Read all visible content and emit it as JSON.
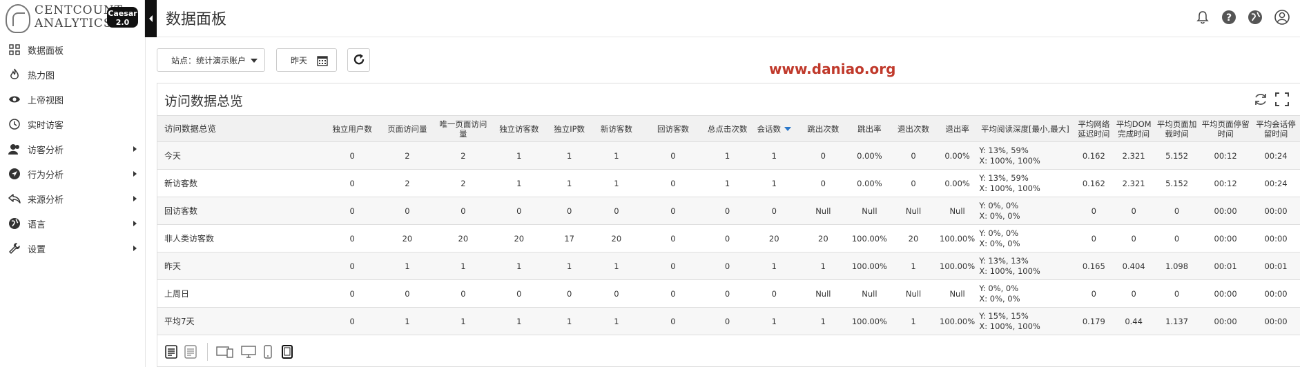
{
  "brand": {
    "line1": "CENTCOUNT",
    "line2": "ANALYTICS",
    "badge_name": "Caesar",
    "badge_version": "2.0"
  },
  "sidebar": {
    "items": [
      {
        "label": "数据面板",
        "icon": "dashboard-icon",
        "has_submenu": false
      },
      {
        "label": "热力图",
        "icon": "flame-icon",
        "has_submenu": false
      },
      {
        "label": "上帝视图",
        "icon": "eye-icon",
        "has_submenu": false
      },
      {
        "label": "实时访客",
        "icon": "clock-icon",
        "has_submenu": false
      },
      {
        "label": "访客分析",
        "icon": "users-icon",
        "has_submenu": true
      },
      {
        "label": "行为分析",
        "icon": "navigation-icon",
        "has_submenu": true
      },
      {
        "label": "来源分析",
        "icon": "reply-icon",
        "has_submenu": true
      },
      {
        "label": "语言",
        "icon": "globe-icon",
        "has_submenu": true
      },
      {
        "label": "设置",
        "icon": "wrench-icon",
        "has_submenu": true
      }
    ]
  },
  "header": {
    "title": "数据面板",
    "icons": [
      "bell-icon",
      "help-icon",
      "globe-icon",
      "user-icon"
    ]
  },
  "toolbar": {
    "site_select": "站点：统计演示账户",
    "date_label": "昨天",
    "refresh_icon": "refresh-icon"
  },
  "watermark": "www.daniao.org",
  "panel": {
    "title": "访问数据总览",
    "controls": [
      "reload-icon",
      "fullscreen-icon"
    ],
    "table": {
      "headers": [
        "访问数据总览",
        "独立用户数",
        "页面访问量",
        "唯一页面访问量",
        "独立访客数",
        "独立IP数",
        "新访客数",
        "回访客数",
        "总点击次数",
        "会话数",
        "跳出次数",
        "跳出率",
        "退出次数",
        "退出率",
        "平均阅读深度[最小,最大]",
        "平均网络延迟时间",
        "平均DOM完成时间",
        "平均页面加载时间",
        "平均页面停留时间",
        "平均会话停留时间"
      ],
      "sorted_column": 9,
      "rows": [
        {
          "label": "今天",
          "values": [
            "0",
            "2",
            "2",
            "1",
            "1",
            "1",
            "0",
            "1",
            "1",
            "0",
            "0.00%",
            "0",
            "0.00%"
          ],
          "depth_y": "Y: 13%, 59%",
          "depth_x": "X: 100%, 100%",
          "tail": [
            "0.162",
            "2.321",
            "5.152",
            "00:12",
            "00:24"
          ]
        },
        {
          "label": "新访客数",
          "values": [
            "0",
            "2",
            "2",
            "1",
            "1",
            "1",
            "0",
            "1",
            "1",
            "0",
            "0.00%",
            "0",
            "0.00%"
          ],
          "depth_y": "Y: 13%, 59%",
          "depth_x": "X: 100%, 100%",
          "tail": [
            "0.162",
            "2.321",
            "5.152",
            "00:12",
            "00:24"
          ]
        },
        {
          "label": "回访客数",
          "values": [
            "0",
            "0",
            "0",
            "0",
            "0",
            "0",
            "0",
            "0",
            "0",
            "Null",
            "Null",
            "Null",
            "Null"
          ],
          "depth_y": "Y: 0%, 0%",
          "depth_x": "X: 0%, 0%",
          "tail": [
            "0",
            "0",
            "0",
            "00:00",
            "00:00"
          ]
        },
        {
          "label": "非人类访客数",
          "values": [
            "0",
            "20",
            "20",
            "20",
            "17",
            "20",
            "0",
            "0",
            "20",
            "20",
            "100.00%",
            "20",
            "100.00%"
          ],
          "depth_y": "Y: 0%, 0%",
          "depth_x": "X: 0%, 0%",
          "tail": [
            "0",
            "0",
            "0",
            "00:00",
            "00:00"
          ]
        },
        {
          "label": "昨天",
          "values": [
            "0",
            "1",
            "1",
            "1",
            "1",
            "1",
            "0",
            "0",
            "1",
            "1",
            "100.00%",
            "1",
            "100.00%"
          ],
          "depth_y": "Y: 13%, 13%",
          "depth_x": "X: 100%, 100%",
          "tail": [
            "0.165",
            "0.404",
            "1.098",
            "00:01",
            "00:01"
          ]
        },
        {
          "label": "上周日",
          "values": [
            "0",
            "0",
            "0",
            "0",
            "0",
            "0",
            "0",
            "0",
            "0",
            "Null",
            "Null",
            "Null",
            "Null"
          ],
          "depth_y": "Y: 0%, 0%",
          "depth_x": "X: 0%, 0%",
          "tail": [
            "0",
            "0",
            "0",
            "00:00",
            "00:00"
          ]
        },
        {
          "label": "平均7天",
          "values": [
            "0",
            "1",
            "1",
            "1",
            "1",
            "1",
            "0",
            "0",
            "1",
            "1",
            "100.00%",
            "1",
            "100.00%"
          ],
          "depth_y": "Y: 15%, 15%",
          "depth_x": "X: 100%, 100%",
          "tail": [
            "0.179",
            "0.44",
            "1.137",
            "00:00",
            "00:00"
          ]
        }
      ]
    },
    "footer_icons": [
      "text-view-icon",
      "list-view-icon",
      "desktop-tablet-icon",
      "desktop-icon",
      "phone-icon",
      "tablet-icon"
    ]
  }
}
